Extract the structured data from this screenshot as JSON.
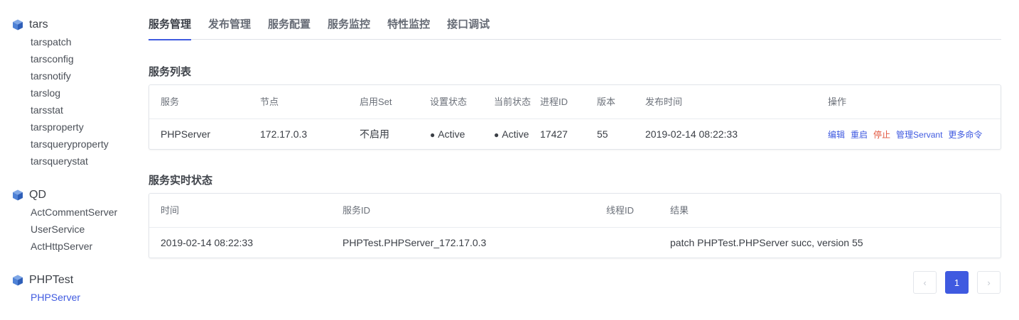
{
  "sidebar": {
    "groups": [
      {
        "title": "tars",
        "items": [
          "tarspatch",
          "tarsconfig",
          "tarsnotify",
          "tarslog",
          "tarsstat",
          "tarsproperty",
          "tarsqueryproperty",
          "tarsquerystat"
        ]
      },
      {
        "title": "QD",
        "items": [
          "ActCommentServer",
          "UserService",
          "ActHttpServer"
        ]
      },
      {
        "title": "PHPTest",
        "items": [
          "PHPServer"
        ]
      }
    ]
  },
  "tabs": [
    "服务管理",
    "发布管理",
    "服务配置",
    "服务监控",
    "特性监控",
    "接口调试"
  ],
  "service_list": {
    "title": "服务列表",
    "headers": {
      "service": "服务",
      "node": "节点",
      "enable_set": "启用Set",
      "setting_status": "设置状态",
      "current_status": "当前状态",
      "pid": "进程ID",
      "version": "版本",
      "publish_time": "发布时间",
      "operations": "操作"
    },
    "row": {
      "service": "PHPServer",
      "node": "172.17.0.3",
      "enable_set": "不启用",
      "setting_status": "Active",
      "current_status": "Active",
      "pid": "17427",
      "version": "55",
      "publish_time": "2019-02-14 08:22:33"
    },
    "ops": {
      "edit": "编辑",
      "restart": "重启",
      "stop": "停止",
      "manage_servant": "管理Servant",
      "more": "更多命令"
    }
  },
  "realtime": {
    "title": "服务实时状态",
    "headers": {
      "time": "时间",
      "service_id": "服务ID",
      "thread_id": "线程ID",
      "result": "结果"
    },
    "row": {
      "time": "2019-02-14 08:22:33",
      "service_id": "PHPTest.PHPServer_172.17.0.3",
      "thread_id": "",
      "result": "patch PHPTest.PHPServer succ, version 55"
    }
  },
  "pagination": {
    "prev": "‹",
    "current": "1",
    "next": "›"
  },
  "colors": {
    "accent": "#3f5ae0",
    "active": "#52c48a",
    "danger": "#e2553d"
  }
}
